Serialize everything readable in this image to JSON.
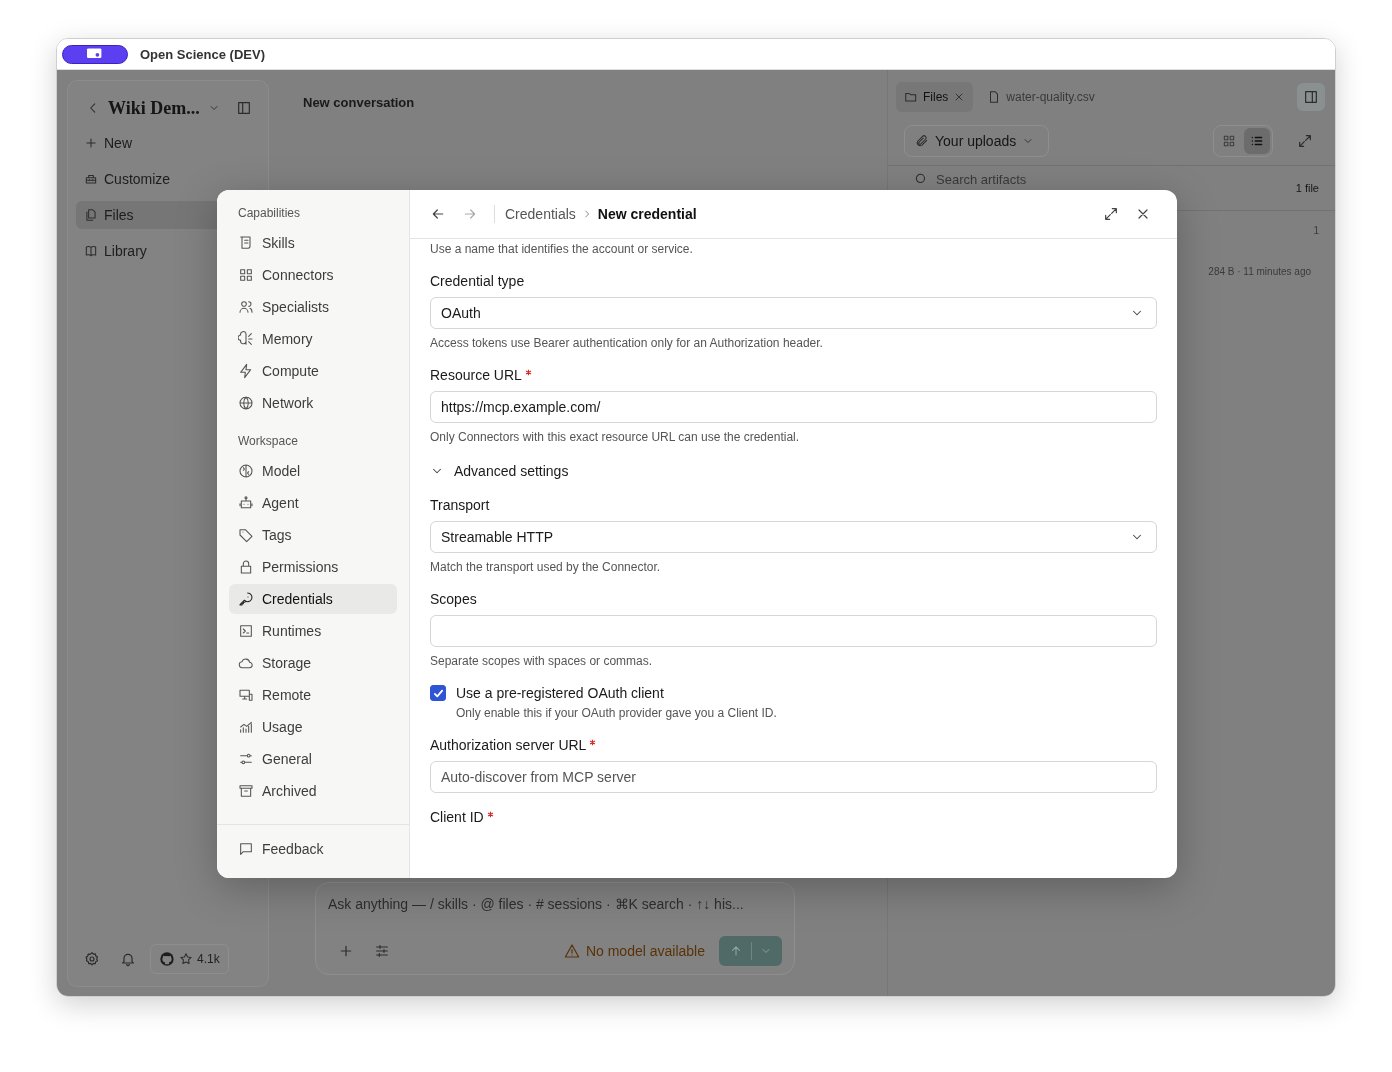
{
  "window": {
    "title": "Open Science (DEV)"
  },
  "sidebar": {
    "workspace": "Wiki Dem...",
    "items": [
      {
        "label": "New",
        "selected": false
      },
      {
        "label": "Customize",
        "selected": false
      },
      {
        "label": "Files",
        "selected": true
      },
      {
        "label": "Library",
        "selected": false
      }
    ],
    "star_count": "4.1k"
  },
  "conversation": {
    "title": "New conversation"
  },
  "composer": {
    "placeholder": "Ask anything — / skills · @ files · # sessions · ⌘K search · ↑↓ his...",
    "warning": "No model available"
  },
  "files_panel": {
    "tabs": [
      {
        "label": "Files",
        "selected": true,
        "closable": true
      },
      {
        "label": "water-quality.csv",
        "selected": false,
        "closable": false
      }
    ],
    "source": "Your uploads",
    "views": [
      {
        "kind": "grid",
        "selected": false
      },
      {
        "kind": "list",
        "selected": true
      }
    ],
    "search_placeholder": "Search artifacts",
    "count": "1 file",
    "row": {
      "column_1": "1",
      "meta": "284 B · 11 minutes ago"
    }
  },
  "dialog": {
    "breadcrumb": [
      "Credentials",
      "New credential"
    ],
    "nav": [
      {
        "heading": "Capabilities",
        "items": [
          {
            "label": "Skills",
            "selected": false
          },
          {
            "label": "Connectors",
            "selected": false
          },
          {
            "label": "Specialists",
            "selected": false
          },
          {
            "label": "Memory",
            "selected": false
          },
          {
            "label": "Compute",
            "selected": false
          },
          {
            "label": "Network",
            "selected": false
          }
        ]
      },
      {
        "heading": "Workspace",
        "items": [
          {
            "label": "Model",
            "selected": false
          },
          {
            "label": "Agent",
            "selected": false
          },
          {
            "label": "Tags",
            "selected": false
          },
          {
            "label": "Permissions",
            "selected": false
          },
          {
            "label": "Credentials",
            "selected": true
          },
          {
            "label": "Runtimes",
            "selected": false
          },
          {
            "label": "Storage",
            "selected": false
          },
          {
            "label": "Remote",
            "selected": false
          },
          {
            "label": "Usage",
            "selected": false
          },
          {
            "label": "General",
            "selected": false
          },
          {
            "label": "Archived",
            "selected": false
          }
        ]
      }
    ],
    "footer_item": "Feedback",
    "intro_hint": "Use a name that identifies the account or service.",
    "fields": [
      {
        "kind": "select",
        "label": "Credential type",
        "required": false,
        "value": "OAuth",
        "hint": "Access tokens use Bearer authentication only for an Authorization header."
      },
      {
        "kind": "input",
        "label": "Resource URL",
        "required": true,
        "value": "https://mcp.example.com/",
        "hint": "Only Connectors with this exact resource URL can use the credential."
      },
      {
        "kind": "section",
        "label": "Advanced settings",
        "expanded": true
      },
      {
        "kind": "select",
        "label": "Transport",
        "required": false,
        "value": "Streamable HTTP",
        "hint": "Match the transport used by the Connector."
      },
      {
        "kind": "input",
        "label": "Scopes",
        "required": false,
        "hint": "Separate scopes with spaces or commas."
      },
      {
        "kind": "checkbox",
        "label": "Use a pre-registered OAuth client",
        "checked": true,
        "hint": "Only enable this if your OAuth provider gave you a Client ID."
      },
      {
        "kind": "input",
        "label": "Authorization server URL",
        "required": true,
        "placeholder": "Auto-discover from MCP server"
      },
      {
        "kind": "label",
        "label": "Client ID",
        "required": true
      }
    ]
  }
}
